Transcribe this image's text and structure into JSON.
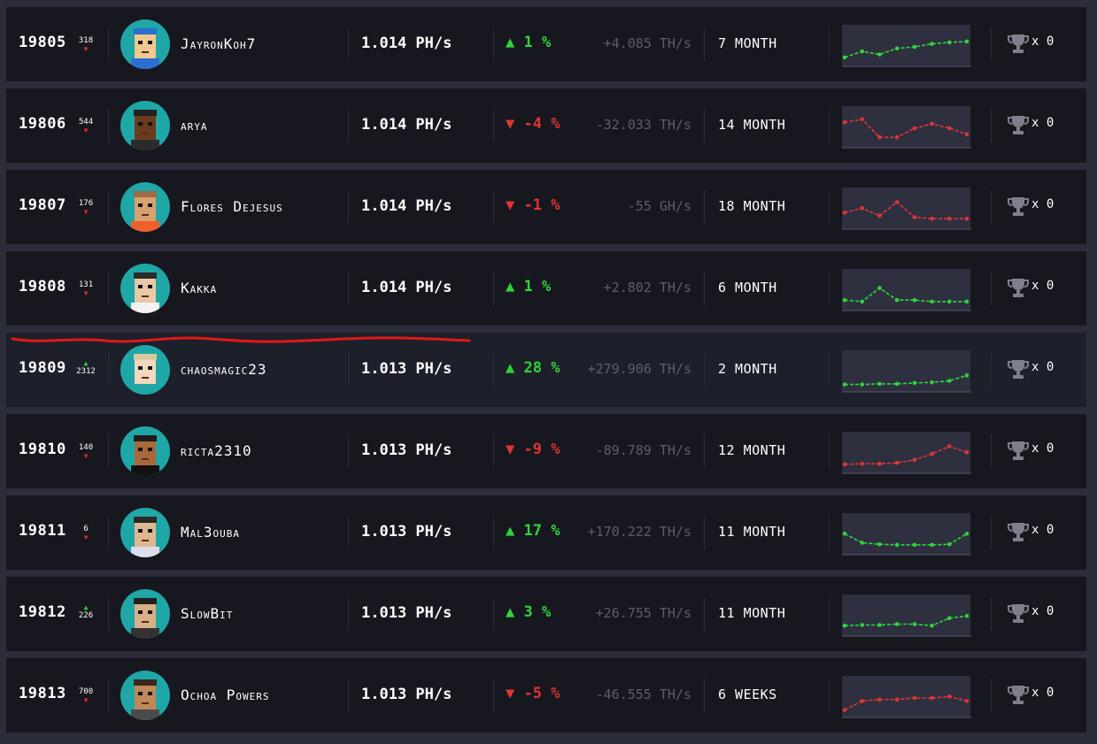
{
  "accents": {
    "up": "#2fd43a",
    "down": "#e03434",
    "annotation": "#e01818"
  },
  "rows": [
    {
      "rank": "19805",
      "rank_change": "318",
      "rank_dir": "down",
      "avatar": "avatar-blue-cap",
      "name": "JayronKoh7",
      "hashrate": "1.014 PH/s",
      "pct_dir": "up",
      "pct": "1 %",
      "delta": "+4.085 TH/s",
      "age": "7 MONTH",
      "trend": "up",
      "spark": [
        0.15,
        0.35,
        0.25,
        0.45,
        0.5,
        0.6,
        0.65,
        0.68
      ],
      "trophy": "x 0"
    },
    {
      "rank": "19806",
      "rank_change": "544",
      "rank_dir": "down",
      "avatar": "avatar-dark-skin",
      "name": "arya",
      "hashrate": "1.014 PH/s",
      "pct_dir": "down",
      "pct": "-4 %",
      "delta": "-32.033 TH/s",
      "age": "14 MONTH",
      "trend": "down",
      "spark": [
        0.7,
        0.8,
        0.2,
        0.2,
        0.5,
        0.65,
        0.5,
        0.3
      ],
      "trophy": "x 0"
    },
    {
      "rank": "19807",
      "rank_change": "176",
      "rank_dir": "down",
      "avatar": "avatar-glasses-orange",
      "name": "Flores Dejesus",
      "hashrate": "1.014 PH/s",
      "pct_dir": "down",
      "pct": "-1 %",
      "delta": "-55 GH/s",
      "age": "18 MONTH",
      "trend": "down",
      "spark": [
        0.4,
        0.55,
        0.3,
        0.75,
        0.25,
        0.2,
        0.2,
        0.2
      ],
      "trophy": "x 0"
    },
    {
      "rank": "19808",
      "rank_change": "131",
      "rank_dir": "down",
      "avatar": "avatar-mustache",
      "name": "Kakka",
      "hashrate": "1.014 PH/s",
      "pct_dir": "up",
      "pct": "1 %",
      "delta": "+2.802 TH/s",
      "age": "6 MONTH",
      "trend": "up",
      "spark": [
        0.2,
        0.15,
        0.6,
        0.2,
        0.2,
        0.15,
        0.15,
        0.15
      ],
      "trophy": "x 0"
    },
    {
      "rank": "19809",
      "rank_change": "2312",
      "rank_dir": "up",
      "avatar": "avatar-pale",
      "name": "chaosmagic23",
      "hashrate": "1.013 PH/s",
      "pct_dir": "up",
      "pct": "28 %",
      "delta": "+279.906 TH/s",
      "age": "2 MONTH",
      "trend": "up",
      "spark": [
        0.1,
        0.1,
        0.12,
        0.12,
        0.15,
        0.17,
        0.22,
        0.4
      ],
      "trophy": "x 0",
      "highlighted": true
    },
    {
      "rank": "19810",
      "rank_change": "140",
      "rank_dir": "down",
      "avatar": "avatar-bearded",
      "name": "ricta2310",
      "hashrate": "1.013 PH/s",
      "pct_dir": "down",
      "pct": "-9 %",
      "delta": "-89.789 TH/s",
      "age": "12 MONTH",
      "trend": "down",
      "spark": [
        0.15,
        0.17,
        0.17,
        0.2,
        0.3,
        0.5,
        0.75,
        0.55
      ],
      "trophy": "x 0"
    },
    {
      "rank": "19811",
      "rank_change": "6",
      "rank_dir": "down",
      "avatar": "avatar-shades",
      "name": "Mal3ouba",
      "hashrate": "1.013 PH/s",
      "pct_dir": "up",
      "pct": "17 %",
      "delta": "+170.222 TH/s",
      "age": "11 MONTH",
      "trend": "up",
      "spark": [
        0.55,
        0.25,
        0.2,
        0.18,
        0.18,
        0.18,
        0.2,
        0.55
      ],
      "trophy": "x 0"
    },
    {
      "rank": "19812",
      "rank_change": "226",
      "rank_dir": "up",
      "avatar": "avatar-sunglasses",
      "name": "SlowBit",
      "hashrate": "1.013 PH/s",
      "pct_dir": "up",
      "pct": "3 %",
      "delta": "+26.755 TH/s",
      "age": "11 MONTH",
      "trend": "up",
      "spark": [
        0.2,
        0.22,
        0.22,
        0.25,
        0.25,
        0.2,
        0.45,
        0.52
      ],
      "trophy": "x 0"
    },
    {
      "rank": "19813",
      "rank_change": "700",
      "rank_dir": "down",
      "avatar": "avatar-ochoa",
      "name": "Ochoa Powers",
      "hashrate": "1.013 PH/s",
      "pct_dir": "down",
      "pct": "-5 %",
      "delta": "-46.555 TH/s",
      "age": "6 WEEKS",
      "trend": "down",
      "spark": [
        0.1,
        0.4,
        0.45,
        0.45,
        0.5,
        0.5,
        0.55,
        0.4
      ],
      "trophy": "x 0"
    }
  ]
}
